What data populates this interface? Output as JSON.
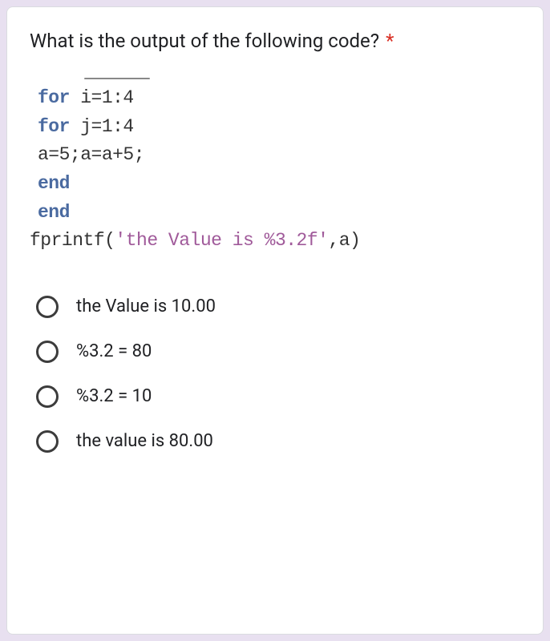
{
  "question": {
    "title": "What is the output of the following code?",
    "required_marker": "*"
  },
  "code": {
    "line1_keyword": "for",
    "line1_rest": " i=1:4",
    "line2_keyword": "for",
    "line2_rest": " j=1:4",
    "line3": "a=5;a=a+5;",
    "line4_keyword": "end",
    "line5_keyword": "end",
    "line6_pre": "fprintf(",
    "line6_str": "'the Value is  %3.2f'",
    "line6_post": ",a)"
  },
  "options": [
    {
      "label": "the Value is 10.00"
    },
    {
      "label": "%3.2 = 80"
    },
    {
      "label": "%3.2 = 10"
    },
    {
      "label": "the value is 80.00"
    }
  ]
}
